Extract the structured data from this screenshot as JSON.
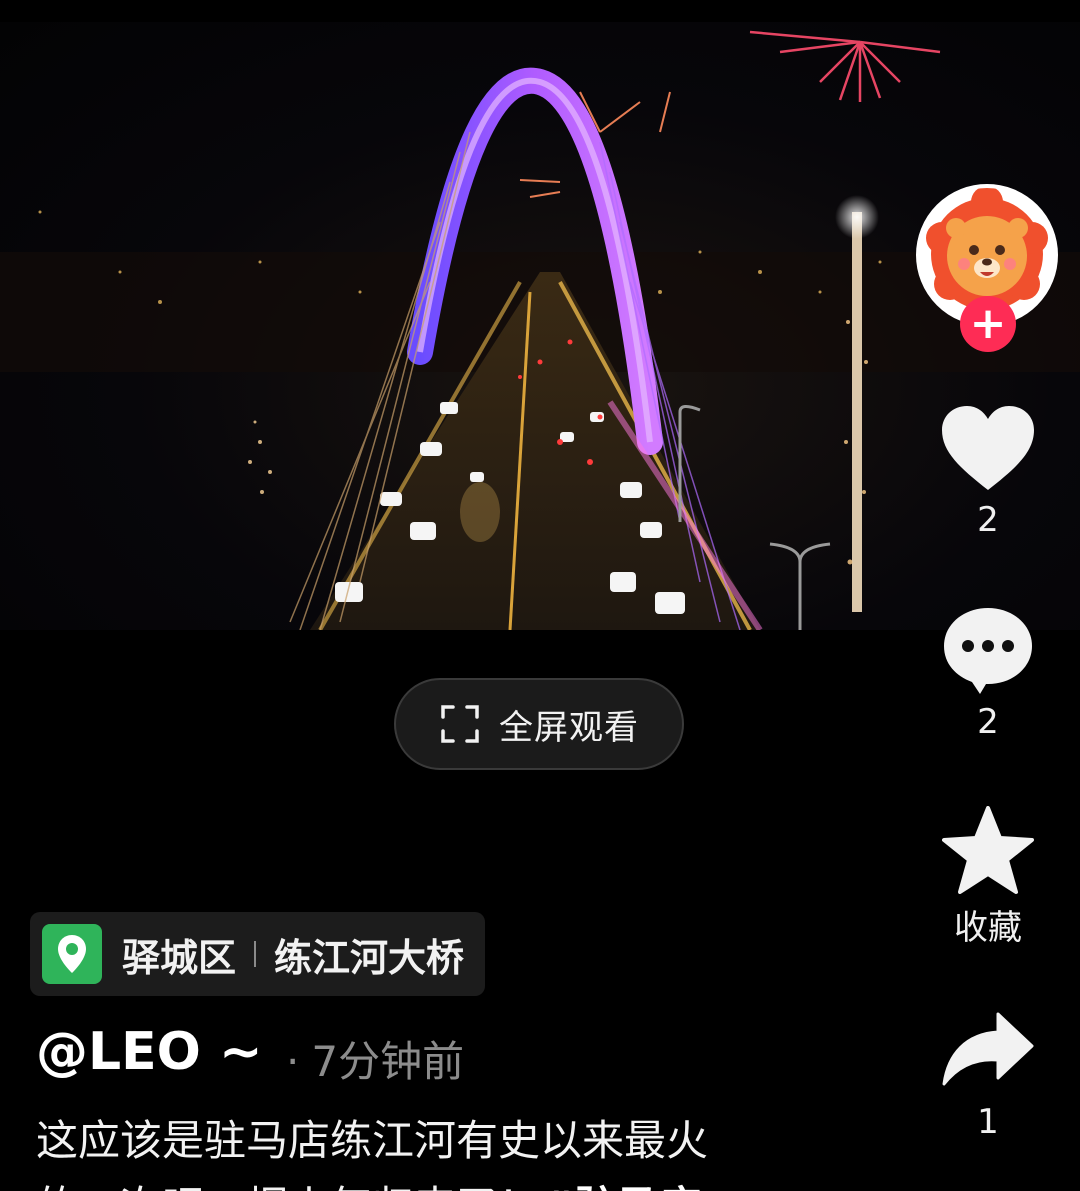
{
  "video": {
    "description_icon": "video-thumbnail"
  },
  "fullscreen_button": {
    "label": "全屏观看",
    "icon": "fullscreen-icon"
  },
  "actions": {
    "follow": "+",
    "like_count": "2",
    "comment_count": "2",
    "favorite_label": "收藏",
    "share_count": "1",
    "icons": [
      "heart-icon",
      "comment-icon",
      "star-icon",
      "share-icon"
    ]
  },
  "location": {
    "district": "驿城区",
    "place": "练江河大桥",
    "icon": "location-pin-icon",
    "color": "#2fb45a"
  },
  "post": {
    "author": "@LEO ~",
    "time_dot": "·",
    "time": "7分钟前",
    "caption_line1": "这应该是驻马店练江河有史以来最火",
    "caption_line2": "的一次吧，烟火气归来了！",
    "hashtag": "#驻马店"
  },
  "colors": {
    "accent": "#fe2c55",
    "background": "#000000"
  }
}
